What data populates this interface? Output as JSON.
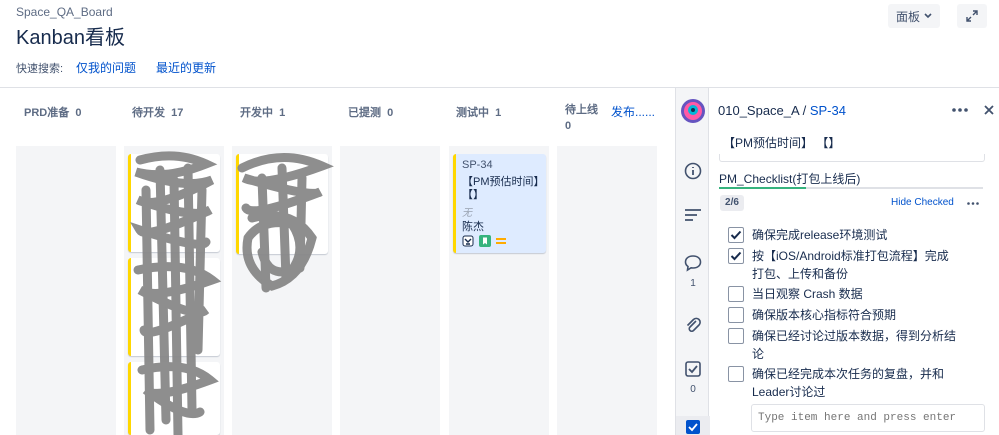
{
  "header": {
    "project": "Space_QA_Board",
    "title": "Kanban看板",
    "board_button": "面板",
    "quick_search_label": "快速搜索:",
    "quick_filters": [
      "仅我的问题",
      "最近的更新"
    ]
  },
  "columns": [
    {
      "name": "PRD准备",
      "count": "0"
    },
    {
      "name": "待开发",
      "count": "17"
    },
    {
      "name": "开发中",
      "count": "1"
    },
    {
      "name": "已提测",
      "count": "0"
    },
    {
      "name": "测试中",
      "count": "1"
    },
    {
      "name": "待上线",
      "count": "0"
    },
    {
      "name": "发布......",
      "count": ""
    }
  ],
  "selected_card": {
    "key": "SP-34",
    "summary": "【PM预估时间】【】",
    "field_empty": "无",
    "assignee": "陈杰"
  },
  "detail": {
    "project": "010_Space_A",
    "separator": " / ",
    "issue_key": "SP-34",
    "summary": "【PM预估时间】 【】",
    "checklist_title": "PM_Checklist(打包上线后)",
    "progress": "2/6",
    "progress_fraction": 0.33,
    "hide_checked": "Hide Checked",
    "items": [
      {
        "text": "确保完成release环境测试",
        "checked": true
      },
      {
        "text": "按【iOS/Android标准打包流程】完成打包、上传和备份",
        "checked": true
      },
      {
        "text": "当日观察 Crash 数据",
        "checked": false
      },
      {
        "text": "确保版本核心指标符合预期",
        "checked": false
      },
      {
        "text": "确保已经讨论过版本数据，得到分析结论",
        "checked": false
      },
      {
        "text": "确保已经完成本次任务的复盘，并和Leader讨论过",
        "checked": false
      }
    ],
    "input_placeholder": "Type item here and press enter"
  },
  "rail": {
    "comments_count": "1",
    "checklist_count": "0"
  },
  "colors": {
    "link": "#0052cc",
    "card_accent": "#ffd700",
    "progress": "#36b37e",
    "column_bg": "#f4f5f7"
  }
}
